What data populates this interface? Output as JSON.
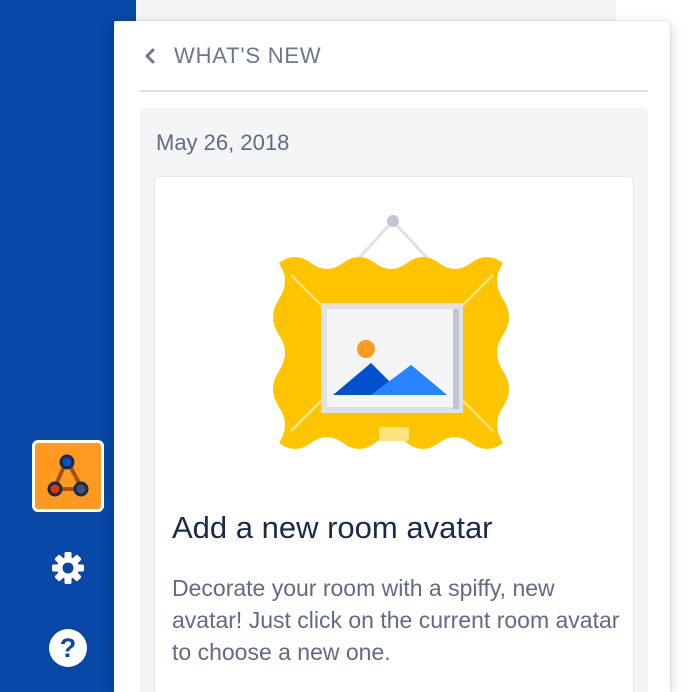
{
  "panel": {
    "title": "WHAT'S NEW",
    "back_icon": "chevron-left-icon"
  },
  "feed": {
    "entries": [
      {
        "date": "May 26, 2018",
        "illustration": "framed-picture-illustration",
        "title": "Add a new room avatar",
        "body": "Decorate your room with a spiffy, new avatar! Just click on the current room avatar to choose a new one."
      }
    ]
  },
  "sidebar": {
    "room_avatar_icon": "webhook-icon",
    "settings_icon": "gear-icon",
    "help_icon": "question-icon"
  },
  "colors": {
    "sidebar": "#0747a6",
    "panel_title": "#6b778c",
    "card_title": "#172b4d",
    "body_text": "#5e6c84",
    "feed_bg": "#f4f5f7",
    "frame_gold": "#ffc400",
    "room_avatar_bg": "#ff991f"
  }
}
